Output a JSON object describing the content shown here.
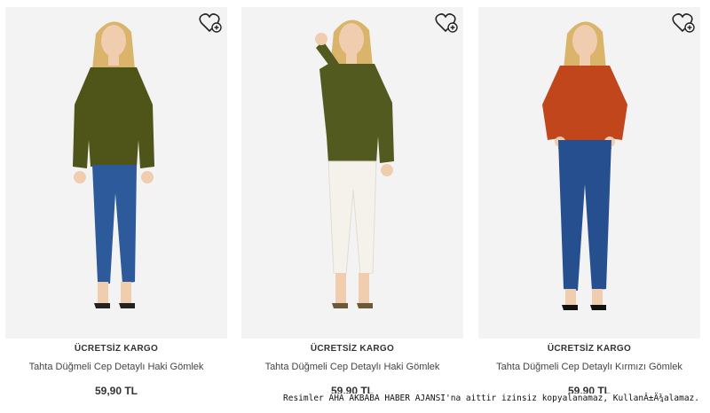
{
  "products": [
    {
      "badge": "ÜCRETSİZ KARGO",
      "name": "Tahta Düğmeli Cep Detaylı Haki Gömlek",
      "price": "59,90 TL",
      "shirt_color": "#4f5419",
      "pants_color": "#2d5a9a",
      "pose": "hands-down"
    },
    {
      "badge": "ÜCRETSİZ KARGO",
      "name": "Tahta Düğmeli Cep Detaylı Haki Gömlek",
      "price": "59,90 TL",
      "shirt_color": "#535a1f",
      "pants_color": "#f4f2ea",
      "pose": "hand-up"
    },
    {
      "badge": "ÜCRETSİZ KARGO",
      "name": "Tahta Düğmeli Cep Detaylı Kırmızı Gömlek",
      "price": "59,90 TL",
      "shirt_color": "#c2461c",
      "pants_color": "#264f8f",
      "pose": "hands-in-pockets"
    }
  ],
  "watermark": "Resimler AHA AKBABA HABER AJANSI'na aittir izinsiz kopyalanamaz, KullanÂ±Ä¾alamaz."
}
